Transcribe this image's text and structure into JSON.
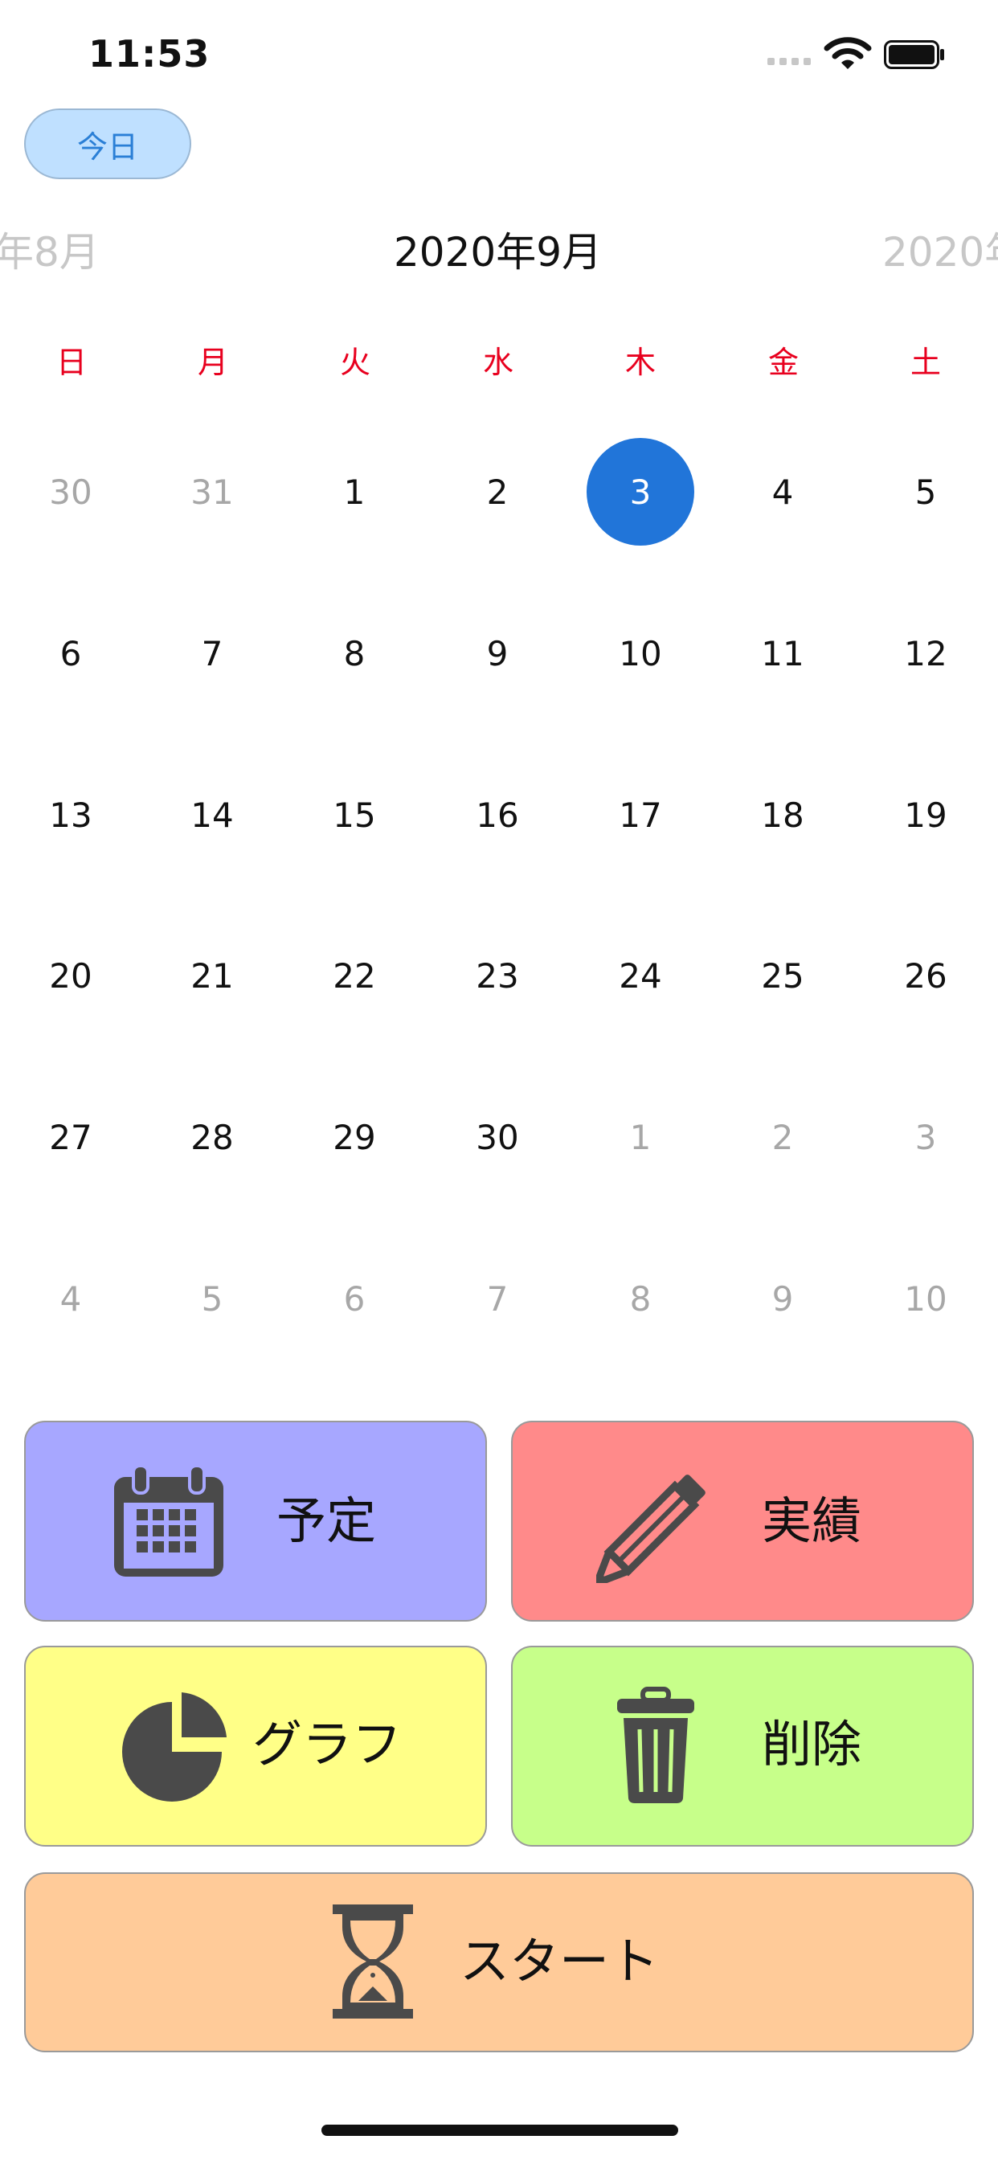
{
  "status_bar": {
    "time": "11:53"
  },
  "today_button": {
    "label": "今日"
  },
  "month_nav": {
    "previous": "年8月",
    "current": "2020年9月",
    "next": "2020年"
  },
  "weekdays": [
    "日",
    "月",
    "火",
    "水",
    "木",
    "金",
    "土"
  ],
  "weeks": [
    [
      "30",
      "31",
      "1",
      "2",
      "3",
      "4",
      "5"
    ],
    [
      "6",
      "7",
      "8",
      "9",
      "10",
      "11",
      "12"
    ],
    [
      "13",
      "14",
      "15",
      "16",
      "17",
      "18",
      "19"
    ],
    [
      "20",
      "21",
      "22",
      "23",
      "24",
      "25",
      "26"
    ],
    [
      "27",
      "28",
      "29",
      "30",
      "1",
      "2",
      "3"
    ],
    [
      "4",
      "5",
      "6",
      "7",
      "8",
      "9",
      "10"
    ]
  ],
  "selected_day": "3",
  "actions": {
    "plan": {
      "label": "予定",
      "icon": "calendar-icon",
      "color": "#a7a7ff"
    },
    "actual": {
      "label": "実績",
      "icon": "pencil-icon",
      "color": "#ff8a8a"
    },
    "graph": {
      "label": "グラフ",
      "icon": "pie-chart-icon",
      "color": "#ffff87"
    },
    "delete": {
      "label": "削除",
      "icon": "trash-icon",
      "color": "#c7ff8a"
    },
    "start": {
      "label": "スタート",
      "icon": "hourglass-icon",
      "color": "#ffcb99"
    }
  },
  "colors": {
    "accent": "#2175d9",
    "weekday_header": "#e8001e",
    "icon": "#4a4a4a"
  }
}
